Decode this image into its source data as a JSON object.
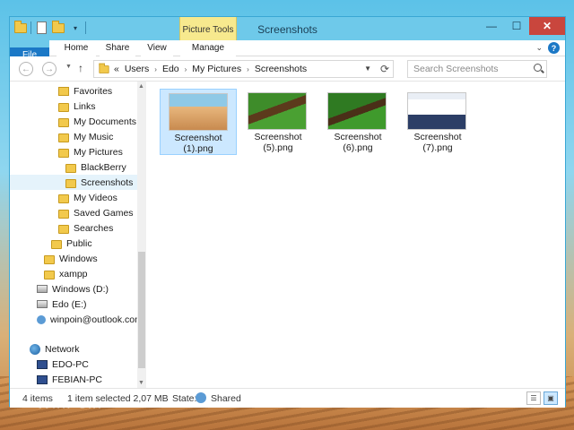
{
  "window": {
    "title": "Screenshots",
    "contextual_tab": "Picture Tools"
  },
  "ribbon": {
    "tabs": [
      {
        "label": "File"
      },
      {
        "label": "Home"
      },
      {
        "label": "Share"
      },
      {
        "label": "View"
      },
      {
        "label": "Manage"
      }
    ],
    "help_glyph": "?"
  },
  "address": {
    "prefix": "«",
    "crumbs": [
      "Users",
      "Edo",
      "My Pictures",
      "Screenshots"
    ],
    "search_placeholder": "Search Screenshots"
  },
  "nav": {
    "items": [
      {
        "label": "Favorites",
        "icon": "folder-icon"
      },
      {
        "label": "Links",
        "icon": "folder-icon"
      },
      {
        "label": "My Documents",
        "icon": "folder-icon"
      },
      {
        "label": "My Music",
        "icon": "folder-icon"
      },
      {
        "label": "My Pictures",
        "icon": "folder-icon"
      },
      {
        "label": "BlackBerry",
        "icon": "folder-icon"
      },
      {
        "label": "Screenshots",
        "icon": "folder-icon"
      },
      {
        "label": "My Videos",
        "icon": "folder-icon"
      },
      {
        "label": "Saved Games",
        "icon": "folder-icon"
      },
      {
        "label": "Searches",
        "icon": "folder-icon"
      },
      {
        "label": "Public",
        "icon": "folder-icon"
      },
      {
        "label": "Windows",
        "icon": "folder-icon"
      },
      {
        "label": "xampp",
        "icon": "folder-icon"
      },
      {
        "label": "Windows (D:)",
        "icon": "drive-icon"
      },
      {
        "label": "Edo (E:)",
        "icon": "drive-icon"
      },
      {
        "label": "winpoin@outlook.com",
        "icon": "user-icon"
      },
      {
        "label": "Network",
        "icon": "network-icon"
      },
      {
        "label": "EDO-PC",
        "icon": "computer-icon"
      },
      {
        "label": "FEBIAN-PC",
        "icon": "computer-icon"
      }
    ],
    "selected": "Screenshots"
  },
  "files": [
    {
      "name_line1": "Screenshot",
      "name_line2": "(1).png",
      "thumb": "desert"
    },
    {
      "name_line1": "Screenshot",
      "name_line2": "(5).png",
      "thumb": "green-field"
    },
    {
      "name_line1": "Screenshot",
      "name_line2": "(6).png",
      "thumb": "green-field"
    },
    {
      "name_line1": "Screenshot",
      "name_line2": "(7).png",
      "thumb": "browser"
    }
  ],
  "status": {
    "item_count": "4 items",
    "selection": "1 item selected  2,07 MB",
    "state_label": "State:",
    "state_value": "Shared"
  },
  "desktop": {
    "watermark": "WinPoin"
  },
  "colors": {
    "window_frame": "#6ec9ea",
    "file_tab": "#1b78c6",
    "picture_tools": "#f7e98e",
    "close_button": "#c9463d",
    "selection": "#cce8ff"
  }
}
